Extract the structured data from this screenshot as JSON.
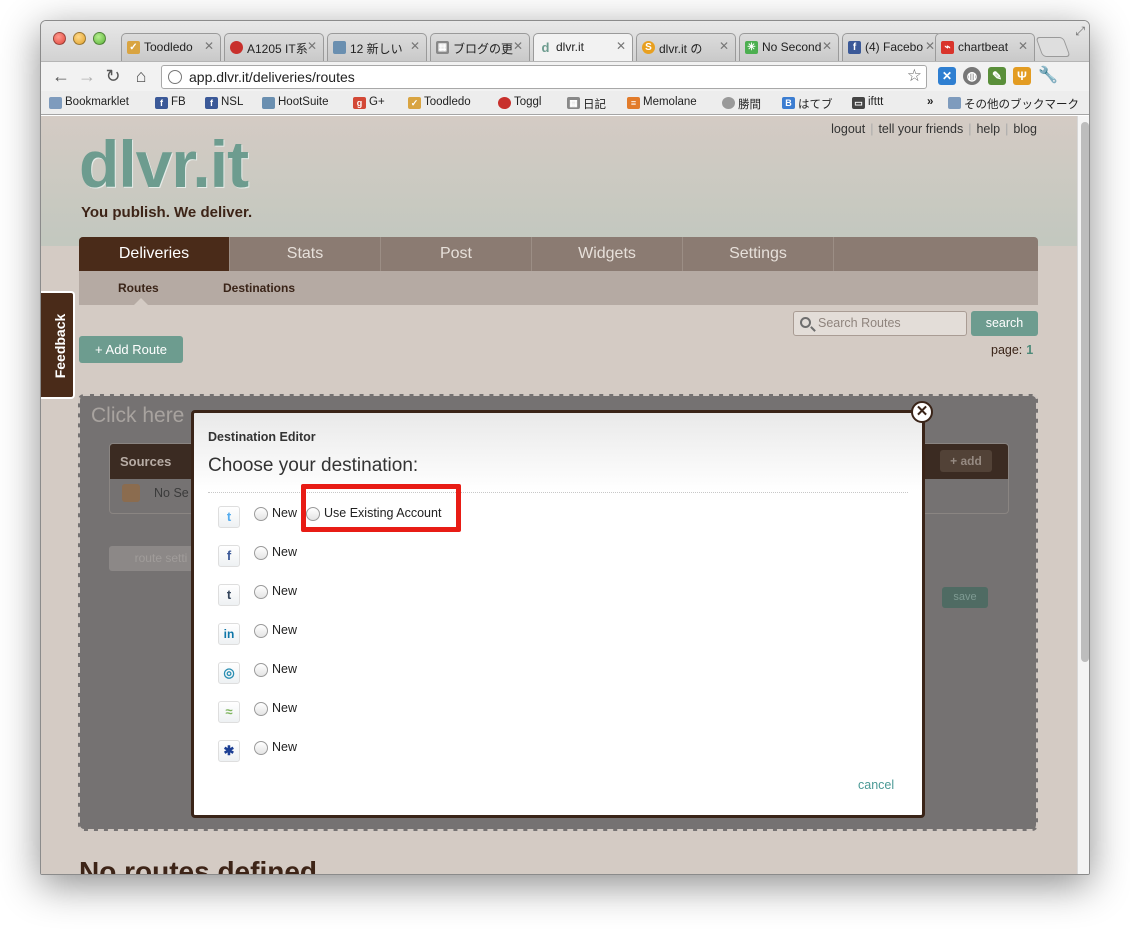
{
  "browser": {
    "tabs": [
      {
        "label": "Toodledo",
        "icon": "toodledo-checkbox-icon",
        "color": "#d9a441"
      },
      {
        "label": "A1205 IT系",
        "icon": "toggl-icon",
        "color": "#c8302c"
      },
      {
        "label": "12 新しい",
        "icon": "hootsuite-icon",
        "color": "#6a8fb0"
      },
      {
        "label": "ブログの更",
        "icon": "grid-icon",
        "color": "#888888"
      },
      {
        "label": "dlvr.it",
        "icon": "dlvr-icon",
        "color": "#6d9c8f"
      },
      {
        "label": "dlvr.it の",
        "icon": "s-icon",
        "color": "#e8a020"
      },
      {
        "label": "No Second",
        "icon": "nosecond-icon",
        "color": "#4caf50"
      },
      {
        "label": "(4) Facebo",
        "icon": "facebook-icon",
        "color": "#3b5998"
      },
      {
        "label": "chartbeat",
        "icon": "chartbeat-icon",
        "color": "#d9342b"
      }
    ],
    "url": "app.dlvr.it/deliveries/routes",
    "bookmarks": [
      {
        "label": "Bookmarklet",
        "icon": "folder-icon",
        "color": "#7e9bbd"
      },
      {
        "label": "FB",
        "icon": "facebook-icon",
        "color": "#3b5998"
      },
      {
        "label": "NSL",
        "icon": "facebook-icon",
        "color": "#3b5998"
      },
      {
        "label": "HootSuite",
        "icon": "hootsuite-icon",
        "color": "#6a8fb0"
      },
      {
        "label": "G+",
        "icon": "googleplus-icon",
        "color": "#d34836"
      },
      {
        "label": "Toodledo",
        "icon": "toodledo-checkbox-icon",
        "color": "#d9a441"
      },
      {
        "label": "Toggl",
        "icon": "toggl-icon",
        "color": "#c8302c"
      },
      {
        "label": "日記",
        "icon": "grid-icon",
        "color": "#888888"
      },
      {
        "label": "Memolane",
        "icon": "memolane-icon",
        "color": "#e27b2a"
      },
      {
        "label": "勝間",
        "icon": "globe-icon",
        "color": "#999999"
      },
      {
        "label": "はてブ",
        "icon": "hatena-b-icon",
        "color": "#3c7dd1"
      },
      {
        "label": "ifttt",
        "icon": "ifttt-icon",
        "color": "#444444"
      }
    ],
    "bookmarks_more": "»",
    "other_bookmarks": "その他のブックマーク"
  },
  "site": {
    "top_links": [
      "logout",
      "tell your friends",
      "help",
      "blog"
    ],
    "logo": "dlvr.it",
    "tagline": "You publish. We deliver.",
    "nav": [
      "Deliveries",
      "Stats",
      "Post",
      "Widgets",
      "Settings"
    ],
    "subnav": [
      "Routes",
      "Destinations"
    ],
    "feedback": "Feedback",
    "search_placeholder": "Search Routes",
    "search_button": "search",
    "page_label": "page:",
    "page_number": "1",
    "add_route": "+ Add Route",
    "route_click_text": "Click here",
    "sources_title": "Sources",
    "sources_add": "+ add",
    "sources_row": "No Se",
    "route_settings": "route setti",
    "route_cancel": "el",
    "route_save": "save",
    "no_routes": "No routes defined"
  },
  "modal": {
    "title": "Destination Editor",
    "subtitle": "Choose your destination:",
    "destinations": [
      {
        "icon": "twitter-icon",
        "glyph": "t",
        "color": "#55acee",
        "new_label": "New",
        "existing_label": "Use Existing Account"
      },
      {
        "icon": "facebook-icon",
        "glyph": "f",
        "color": "#3b5998",
        "new_label": "New"
      },
      {
        "icon": "tumblr-icon",
        "glyph": "t",
        "color": "#35465c",
        "new_label": "New"
      },
      {
        "icon": "linkedin-icon",
        "glyph": "in",
        "color": "#0e76a8",
        "new_label": "New"
      },
      {
        "icon": "ping-icon",
        "glyph": "◎",
        "color": "#2b8fb3",
        "new_label": "New"
      },
      {
        "icon": "rss-icon",
        "glyph": "≈",
        "color": "#7fb55f",
        "new_label": "New"
      },
      {
        "icon": "myspace-icon",
        "glyph": "✱",
        "color": "#1c3f94",
        "new_label": "New"
      }
    ],
    "cancel": "cancel",
    "close_glyph": "✕",
    "highlight_color": "#e81c15"
  }
}
